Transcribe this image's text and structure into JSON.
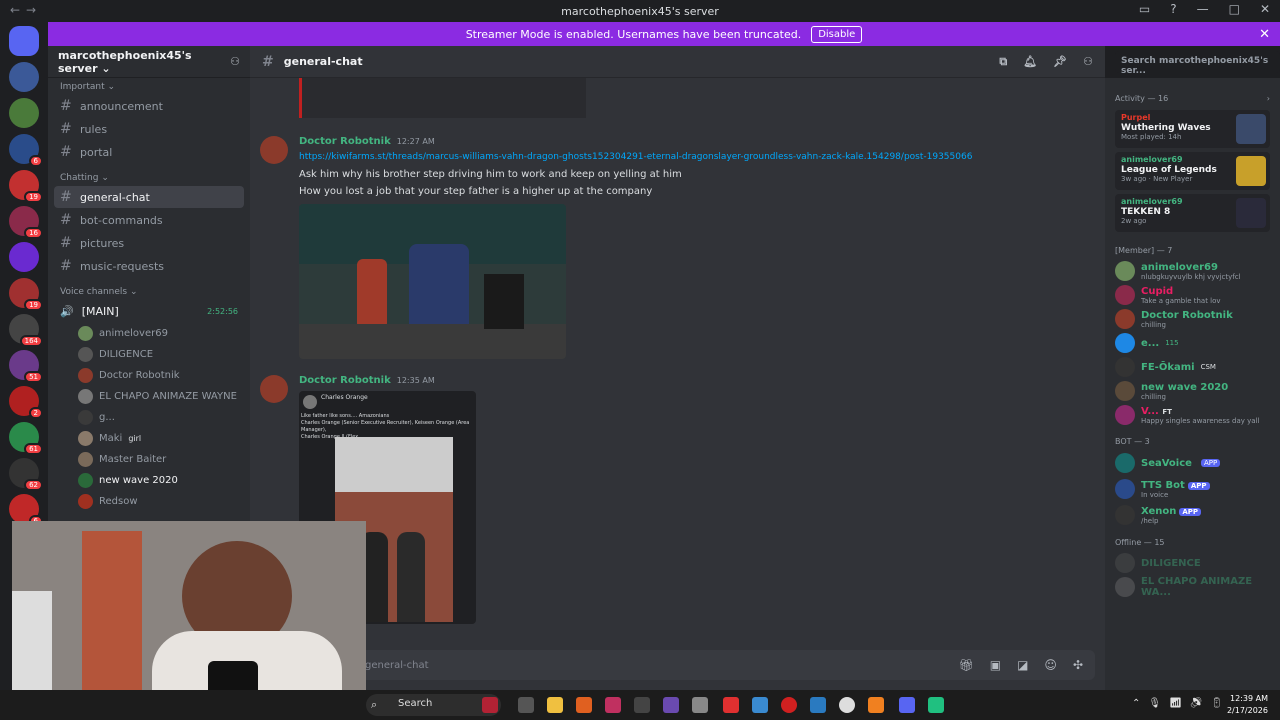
{
  "window": {
    "title": "marcothephoenix45's server"
  },
  "banner": {
    "text": "Streamer Mode is enabled. Usernames have been truncated.",
    "button": "Disable"
  },
  "server_badges": [
    "6",
    "19",
    "16",
    "19",
    "164",
    "51",
    "2",
    "61",
    "62",
    "6"
  ],
  "sidebar": {
    "guild_name": "marcothephoenix45's server",
    "cat_important": "Important",
    "ch_announcement": "announcement",
    "ch_rules": "rules",
    "ch_portal": "portal",
    "cat_chatting": "Chatting",
    "ch_general": "general-chat",
    "ch_bot": "bot-commands",
    "ch_pictures": "pictures",
    "ch_music": "music-requests",
    "cat_voice": "Voice channels",
    "voice_main": "[MAIN]",
    "voice_timer": "2:52:56",
    "voice_users": [
      "animelover69",
      "DILIGENCE",
      "Doctor Robotnik",
      "EL CHAPO ANIMAZE WAYNE",
      "g...",
      "Maki",
      "Master Baiter",
      "new wave 2020",
      "Redsow"
    ],
    "maki_tag": "girl"
  },
  "header": {
    "channel": "general-chat",
    "search": "Search marcothephoenix45's ser..."
  },
  "messages": {
    "m1_name": "Doctor Robotnik",
    "m1_time": "12:27 AM",
    "m1_link": "https://kiwifarms.st/threads/marcus-williams-vahn-dragon-ghosts152304291-eternal-dragonslayer-groundless-vahn-zack-kale.154298/post-19355066",
    "m1_l2": "Ask him why his brother step driving him to work and keep on yelling at him",
    "m1_l3": "How you lost a job that your step father is a higher up at the company",
    "m2_name": "Doctor Robotnik",
    "m2_time": "12:35 AM",
    "m2_img_name": "Charles Orange",
    "m2_img_text": "Like father like sons.... Amazonians",
    "m2_img_line2": "Charles Orange (Senior Executive Recruiter), Keiseen Orange (Area Manager),",
    "m2_img_line3": "Charles Orange II (Flex"
  },
  "input": {
    "placeholder": "general-chat"
  },
  "members": {
    "activity_header": "Activity — 16",
    "acts": [
      {
        "who": "Purpel",
        "game": "Wuthering Waves",
        "sub": "Most played: 14h"
      },
      {
        "who": "animelover69",
        "game": "League of Legends",
        "sub": "3w ago · New Player"
      },
      {
        "who": "animelover69",
        "game": "TEKKEN 8",
        "sub": "2w ago"
      }
    ],
    "member_header": "[Member] — 7",
    "list": [
      {
        "name": "animelover69",
        "status": "nlubgkuyvuylb khj vyvjctyfcl"
      },
      {
        "name": "Cupid",
        "status": "Take a gamble that lov"
      },
      {
        "name": "Doctor Robotnik",
        "status": "chilling"
      },
      {
        "name": "e...",
        "status": ""
      },
      {
        "name": "FE-Ōkami",
        "status": ""
      },
      {
        "name": "new wave 2020",
        "status": "chilling"
      },
      {
        "name": "V...",
        "status": "Happy singles awareness day yall"
      }
    ],
    "e_tag": "115",
    "fe_tag": "CSM",
    "v_tag": "FT",
    "bot_header": "BOT — 3",
    "bots": [
      {
        "name": "SeaVoice",
        "status": ""
      },
      {
        "name": "TTS Bot",
        "status": "In voice"
      },
      {
        "name": "Xenon",
        "status": "/help"
      }
    ],
    "app_tag": "APP",
    "offline_header": "Offline — 15",
    "offline": [
      "DILIGENCE",
      "EL CHAPO ANIMAZE WA..."
    ]
  },
  "taskbar": {
    "search": "Search",
    "time": "12:39 AM",
    "date": "2/17/2026"
  }
}
